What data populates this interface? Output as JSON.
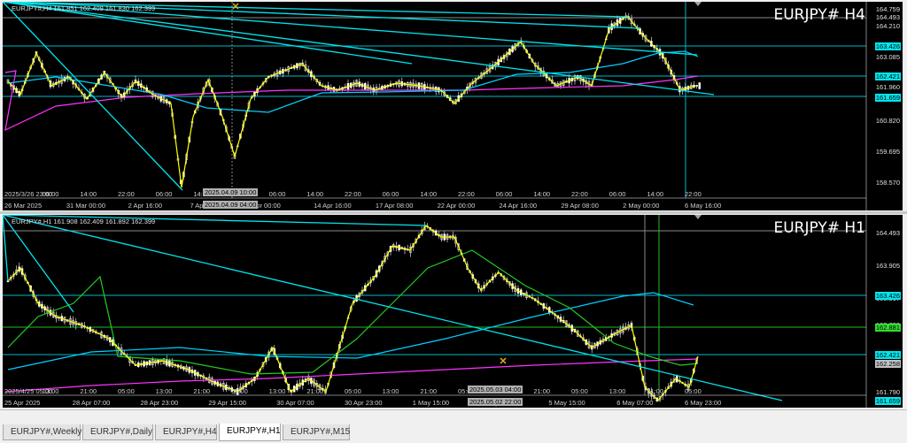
{
  "h4": {
    "info": "EURJPY#,H4  161.851 162.409 161.830 162.399",
    "title": "EURJPY#  H4",
    "price_labels": [
      "164.759",
      "164.493",
      "164.210",
      "163.085",
      "161.960",
      "160.820",
      "159.695",
      "158.570"
    ],
    "tags": [
      {
        "text": "163.426",
        "color": "#00e5ee"
      },
      {
        "text": "162.421",
        "color": "#00e5ee"
      },
      {
        "text": "161.659",
        "color": "#00e5ee"
      }
    ],
    "time_labels": [
      "26 Mar 2025",
      "31 Mar 00:00",
      "2 Apr 16:00",
      "7 Apr",
      "Apr 00:00",
      "14 Apr 16:00",
      "17 Apr 08:00",
      "22 Apr 00:00",
      "24 Apr 16:00",
      "29 Apr 08:00",
      "2 May 00:00",
      "6 May 16:00"
    ],
    "upper_time_labels": [
      "2025/3/26 23:00",
      "06:00",
      "14:00",
      "22:00",
      "06:00",
      "14:00",
      "22:00",
      "06:00",
      "14:00",
      "22:00",
      "06:00",
      "14:00",
      "22:00",
      "06:00",
      "14:00",
      "22:00",
      "06:00",
      "14:00",
      "22:00"
    ],
    "hilite_upper": "2025.04.09 10:00",
    "hilite_lower": "2025.04.09 04:00"
  },
  "h1": {
    "info": "EURJPY#,H1  161.908 162.409 161.892 162.399",
    "title": "EURJPY#  H1",
    "price_labels": [
      "164.493",
      "163.905",
      "163.317",
      "162.729",
      "161.790"
    ],
    "tags": [
      {
        "text": "163.426",
        "color": "#00e5ee"
      },
      {
        "text": "162.881",
        "color": "#33dd33"
      },
      {
        "text": "162.421",
        "color": "#00e5ee"
      },
      {
        "text": "162.258",
        "color": "#c0c0c0"
      },
      {
        "text": "161.659",
        "color": "#00e5ee"
      }
    ],
    "time_labels": [
      "25 Apr 2025",
      "28 Apr 07:00",
      "28 Apr 23:00",
      "29 Apr 15:00",
      "30 Apr 07:00",
      "30 Apr 23:00",
      "1 May 15:00",
      "2 May 07",
      "5 May 15:00",
      "6 May 07:00",
      "6 May 23:00"
    ],
    "upper_time_labels": [
      "2025/4/25 05:00",
      "13:00",
      "21:00",
      "05:00",
      "13:00",
      "21:00",
      "05:00",
      "13:00",
      "21:00",
      "05:00",
      "13:00",
      "21:00",
      "05:00",
      "13:00",
      "21:00",
      "05:00",
      "13:00",
      "21:00",
      "05:00"
    ],
    "hilite_upper": "2025.05.03 04:00",
    "hilite_lower": "2025.05.02 22:00"
  },
  "tabs": [
    "EURJPY#,Weekly",
    "EURJPY#,Daily",
    "EURJPY#,H4",
    "EURJPY#,H1",
    "EURJPY#,M15"
  ],
  "active_tab": "EURJPY#,H1",
  "colors": {
    "background": "#000000",
    "bull_candle": "#ffffff",
    "bear_candle": "#c8c8c8",
    "trendline": "#00e5ee",
    "zigzag": "#ffff00",
    "ma_fast": "#22cc22",
    "ma_slow": "#00d0ff",
    "ma_long": "#ff33ff"
  },
  "icons": {
    "crosshair": "crosshair-icon",
    "scroll_marker": "triangle-down-icon"
  }
}
